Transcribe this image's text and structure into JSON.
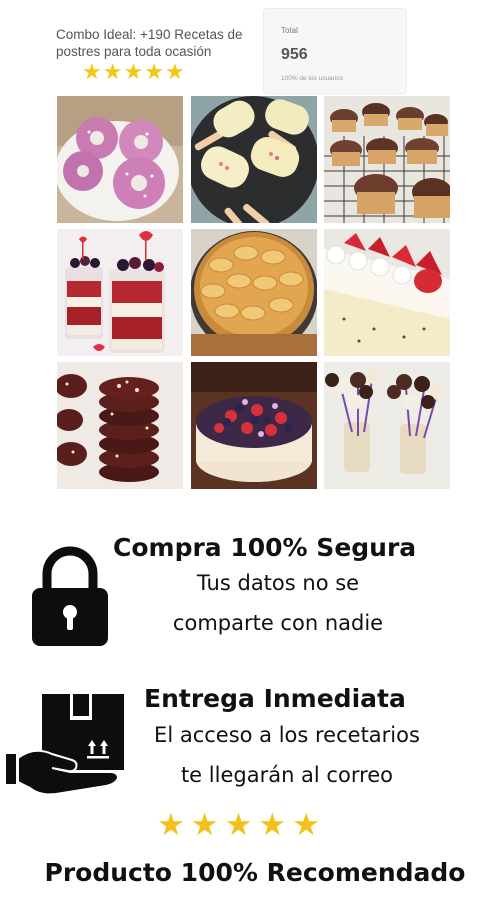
{
  "header": {
    "combo_line1": "Combo Ideal: +190 Recetas de",
    "combo_line2": "postres para toda ocasión",
    "stars_count": 5,
    "star_glyph": "★"
  },
  "total_card": {
    "label": "Total",
    "value": "956",
    "caption": "100% de los usuarios"
  },
  "gallery": {
    "tiles": [
      {
        "icon": "donuts-image"
      },
      {
        "icon": "ice-pops-image"
      },
      {
        "icon": "cupcakes-image"
      },
      {
        "icon": "red-velvet-cups-image"
      },
      {
        "icon": "apple-tart-image"
      },
      {
        "icon": "strawberry-cake-image"
      },
      {
        "icon": "chocolate-cookies-image"
      },
      {
        "icon": "berry-cheesecake-image"
      },
      {
        "icon": "cake-pops-image"
      }
    ]
  },
  "secure": {
    "title": "Compra 100% Segura",
    "line1": "Tus datos no se",
    "line2": "comparte con nadie",
    "icon": "lock-icon"
  },
  "delivery": {
    "title": "Entrega Inmediata",
    "line1": "El acceso a los recetarios",
    "line2": "te llegarán al correo",
    "icon": "box-hand-icon"
  },
  "rating": {
    "stars_count": 5,
    "star_color": "#f2c21b"
  },
  "footer": {
    "title": "Producto 100% Recomendado"
  }
}
